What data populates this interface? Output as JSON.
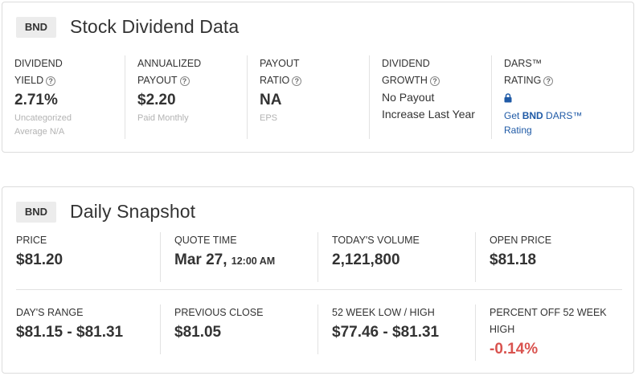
{
  "dividend": {
    "ticker": "BND",
    "title": "Stock Dividend Data",
    "yield": {
      "label1": "DIVIDEND",
      "label2": "YIELD",
      "value": "2.71%",
      "note1": "Uncategorized",
      "note2": "Average N/A"
    },
    "annualized": {
      "label1": "ANNUALIZED",
      "label2": "PAYOUT",
      "value": "$2.20",
      "note": "Paid Monthly"
    },
    "payout_ratio": {
      "label1": "PAYOUT",
      "label2": "RATIO",
      "value": "NA",
      "note": "EPS"
    },
    "growth": {
      "label1": "DIVIDEND",
      "label2": "GROWTH",
      "line1": "No Payout",
      "line2": "Increase Last Year"
    },
    "dars": {
      "label1": "DARS™",
      "label2": "RATING",
      "link_prefix": "Get ",
      "link_ticker": "BND",
      "link_suffix": " DARS™",
      "link_line2": "Rating"
    },
    "help_glyph": "?"
  },
  "snapshot": {
    "ticker": "BND",
    "title": "Daily Snapshot",
    "price": {
      "label": "PRICE",
      "value": "$81.20"
    },
    "quote_time": {
      "label": "QUOTE TIME",
      "date": "Mar 27,",
      "time": "12:00 AM"
    },
    "volume": {
      "label": "TODAY'S VOLUME",
      "value": "2,121,800"
    },
    "open_price": {
      "label": "OPEN PRICE",
      "value": "$81.18"
    },
    "days_range": {
      "label": "DAY'S RANGE",
      "value": "$81.15 - $81.31"
    },
    "prev_close": {
      "label": "PREVIOUS CLOSE",
      "value": "$81.05"
    },
    "week52": {
      "label": "52 WEEK LOW / HIGH",
      "value": "$77.46 - $81.31"
    },
    "pct_off": {
      "label1": "PERCENT OFF 52 WEEK",
      "label2": "HIGH",
      "value": "-0.14%"
    }
  },
  "colors": {
    "negative": "#d9534f",
    "link": "#1f5aa6",
    "badge_bg": "#ececec"
  },
  "icons": {
    "help": "help-circle-icon",
    "lock": "lock-icon"
  }
}
